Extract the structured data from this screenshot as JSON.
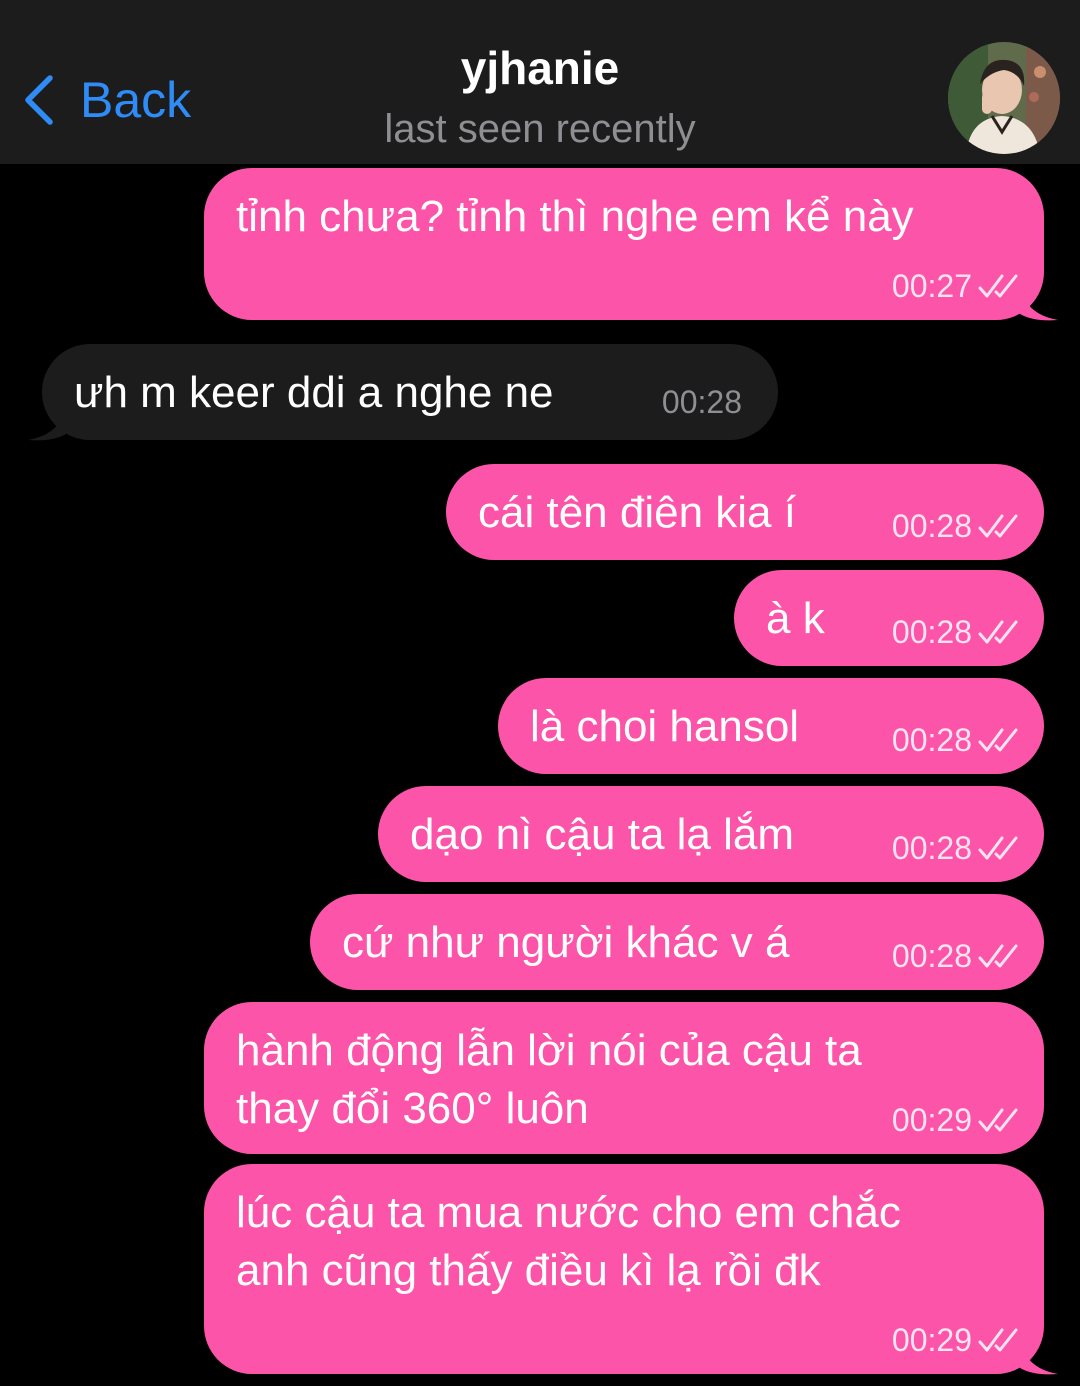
{
  "header": {
    "back_label": "Back",
    "title": "yjhanie",
    "status": "last seen recently"
  },
  "colors": {
    "outgoing_bubble": "#fc54a8",
    "incoming_bubble": "#1c1c1d",
    "accent": "#2f8cf6",
    "background": "#000000"
  },
  "messages": [
    {
      "direction": "outgoing",
      "lines": [
        "tỉnh chưa? tỉnh thì nghe em kể này"
      ],
      "time": "00:27",
      "read": true
    },
    {
      "direction": "incoming",
      "lines": [
        "ưh m keer ddi a nghe ne"
      ],
      "time": "00:28"
    },
    {
      "direction": "outgoing",
      "lines": [
        "cái tên điên kia í"
      ],
      "time": "00:28",
      "read": true
    },
    {
      "direction": "outgoing",
      "lines": [
        "à k"
      ],
      "time": "00:28",
      "read": true
    },
    {
      "direction": "outgoing",
      "lines": [
        "là choi hansol"
      ],
      "time": "00:28",
      "read": true
    },
    {
      "direction": "outgoing",
      "lines": [
        "dạo nì cậu ta lạ lắm"
      ],
      "time": "00:28",
      "read": true
    },
    {
      "direction": "outgoing",
      "lines": [
        "cứ như người khác v á"
      ],
      "time": "00:28",
      "read": true
    },
    {
      "direction": "outgoing",
      "lines": [
        "hành động lẫn lời nói của cậu ta",
        "thay đổi 360° luôn"
      ],
      "time": "00:29",
      "read": true
    },
    {
      "direction": "outgoing",
      "lines": [
        "lúc cậu ta mua nước cho em chắc",
        "anh cũng thấy điều kì lạ rồi đk"
      ],
      "time": "00:29",
      "read": true
    }
  ]
}
